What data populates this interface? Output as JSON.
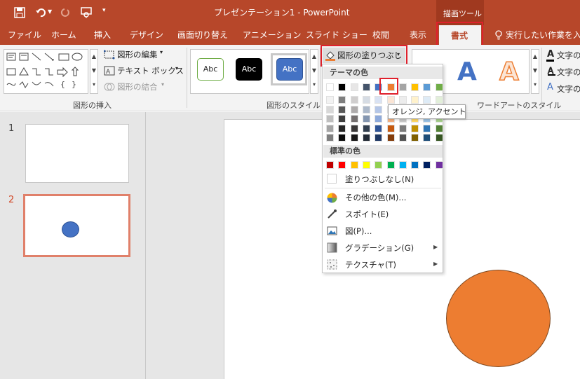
{
  "titlebar": {
    "title": "プレゼンテーション1  -  PowerPoint",
    "context_tab_group": "描画ツール",
    "qat_icons": [
      "save-icon",
      "undo-icon",
      "redo-icon",
      "present-icon",
      "customize-icon"
    ]
  },
  "tabs": [
    "ファイル",
    "ホーム",
    "挿入",
    "デザイン",
    "画面切り替え",
    "アニメーション",
    "スライド ショー",
    "校閲",
    "表示",
    "書式"
  ],
  "tell_me": "実行したい作業を入力",
  "ribbon": {
    "insert_shapes": {
      "edit_shape": "図形の編集",
      "text_box": "テキスト ボックス",
      "merge": "図形の結合",
      "label": "図形の挿入"
    },
    "shape_styles": {
      "presets": [
        "Abc",
        "Abc",
        "Abc"
      ],
      "fill_button": "図形の塗りつぶし",
      "label": "図形のスタイル"
    },
    "wordart": {
      "label": "ワードアートのスタイル",
      "letters": [
        "A",
        "A"
      ],
      "text_fill": "文字の",
      "text_outline": "文字の",
      "text_effects": "文字の"
    }
  },
  "slides": {
    "items": [
      {
        "number": "1"
      },
      {
        "number": "2"
      }
    ]
  },
  "fill_menu": {
    "theme_colors_label": "テーマの色",
    "theme_top": [
      "#FFFFFF",
      "#000000",
      "#E7E6E6",
      "#44546A",
      "#4472C4",
      "#ED7D31",
      "#A5A5A5",
      "#FFC000",
      "#5B9BD5",
      "#70AD47"
    ],
    "theme_shades": [
      [
        "#F2F2F2",
        "#7F7F7F",
        "#D0CECE",
        "#D6DCE4",
        "#D9E2F3",
        "#FBE5D5",
        "#EDEDED",
        "#FFF2CC",
        "#DEEBF6",
        "#E2EFD9"
      ],
      [
        "#D8D8D8",
        "#595959",
        "#AEABAB",
        "#ADB9CA",
        "#B4C6E7",
        "#F7CBAC",
        "#DBDBDB",
        "#FEE599",
        "#BDD7EE",
        "#C5E0B3"
      ],
      [
        "#BFBFBF",
        "#3F3F3F",
        "#757070",
        "#8496B0",
        "#8EAADB",
        "#F4B183",
        "#C9C9C9",
        "#FFD965",
        "#9CC3E5",
        "#A8D08D"
      ],
      [
        "#A5A5A5",
        "#262626",
        "#3A3838",
        "#323F4F",
        "#2F5496",
        "#C55A11",
        "#7B7B7B",
        "#BF9000",
        "#2E75B5",
        "#538135"
      ],
      [
        "#7F7F7F",
        "#0C0C0C",
        "#171616",
        "#222A35",
        "#1F3864",
        "#833C0B",
        "#525252",
        "#7F6000",
        "#1E4E79",
        "#375623"
      ]
    ],
    "standard_colors_label": "標準の色",
    "standard": [
      "#C00000",
      "#FF0000",
      "#FFC000",
      "#FFFF00",
      "#92D050",
      "#00B050",
      "#00B0F0",
      "#0070C0",
      "#002060",
      "#7030A0"
    ],
    "no_fill": "塗りつぶしなし(N)",
    "more_colors": "その他の色(M)...",
    "eyedropper": "スポイト(E)",
    "picture": "図(P)...",
    "gradient": "グラデーション(G)",
    "texture": "テクスチャ(T)"
  },
  "tooltip": "オレンジ, アクセント 2",
  "colors": {
    "accent": "#B7472A",
    "shape_fill": "#ED7D31",
    "thumb_circle": "#4472C4"
  }
}
